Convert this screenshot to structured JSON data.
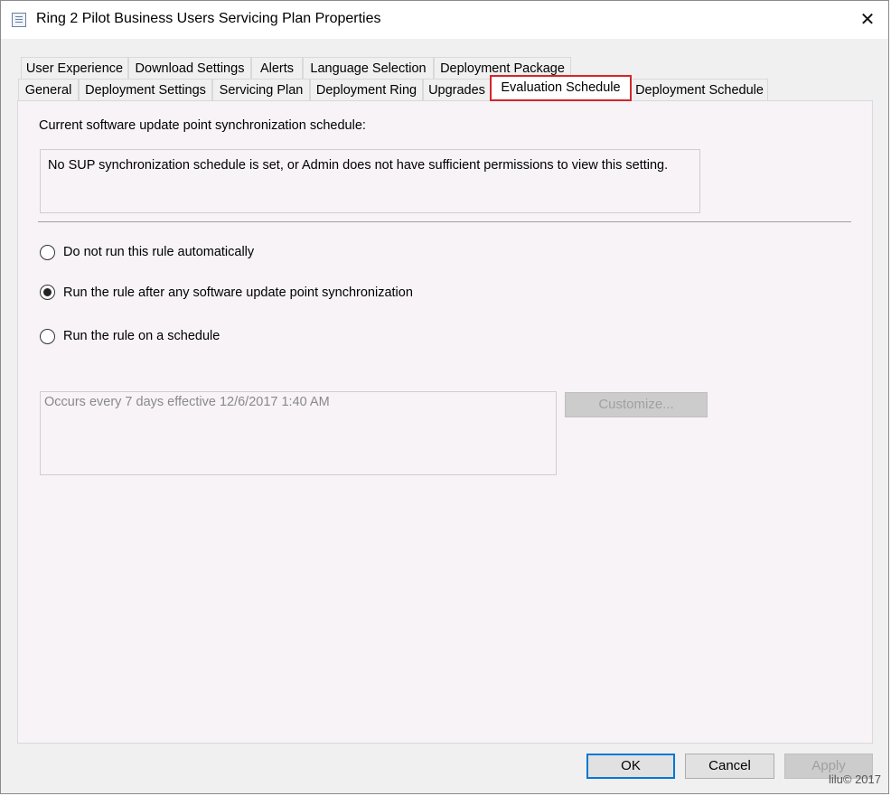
{
  "window": {
    "title": "Ring 2 Pilot Business Users Servicing Plan Properties",
    "close_symbol": "✕",
    "icon": "properties-icon"
  },
  "tabs_row1": [
    "User Experience",
    "Download Settings",
    "Alerts",
    "Language Selection",
    "Deployment Package"
  ],
  "tabs_row2": [
    "General",
    "Deployment Settings",
    "Servicing Plan",
    "Deployment Ring",
    "Upgrades",
    "Evaluation Schedule",
    "Deployment Schedule"
  ],
  "active_tab": "Evaluation Schedule",
  "highlight_color": "#d4252b",
  "sync_schedule": {
    "label": "Current software update point synchronization schedule:",
    "value": "No SUP synchronization schedule is set, or Admin does not have sufficient permissions to view this setting."
  },
  "options": {
    "do_not_run": "Do not run this rule automatically",
    "after_sync": "Run the rule after any software update point synchronization",
    "on_schedule": "Run the rule on a schedule",
    "selected": "after_sync"
  },
  "schedule": {
    "value": "Occurs every 7 days effective 12/6/2017 1:40 AM",
    "customize_label": "Customize..."
  },
  "buttons": {
    "ok": "OK",
    "cancel": "Cancel",
    "apply": "Apply"
  },
  "watermark": "lilu© 2017"
}
